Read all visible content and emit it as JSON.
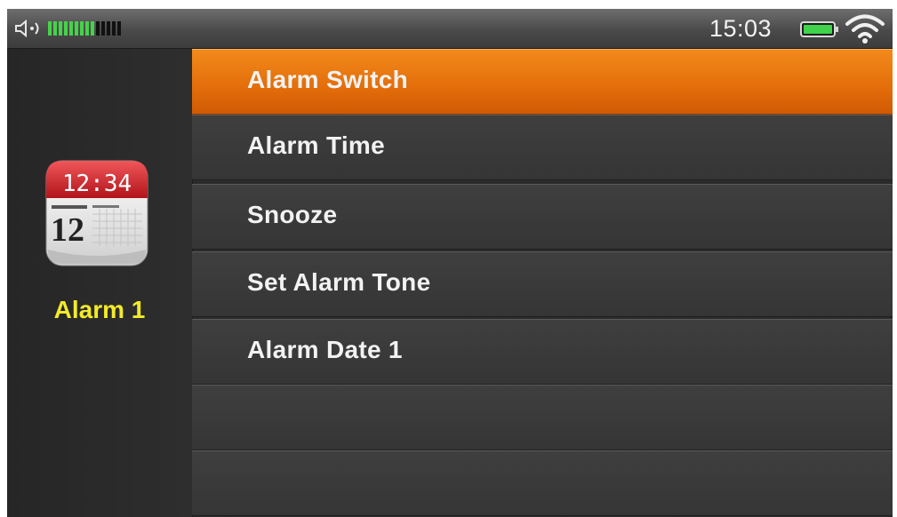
{
  "status_bar": {
    "time": "15:03",
    "volume_level": 0.6,
    "icons": [
      "speaker-icon",
      "battery-icon",
      "wifi-icon"
    ],
    "colors": {
      "volume_on": "#46d24a",
      "battery": "#3fd24a"
    }
  },
  "sidebar": {
    "app_label": "Alarm 1",
    "app_icon": "calendar-clock-icon",
    "icon_time_display": "12:34",
    "icon_date_number": "12",
    "colors": {
      "label": "#f2ea2a"
    }
  },
  "menu": {
    "selected_index": 0,
    "items": [
      {
        "label": "Alarm Switch"
      },
      {
        "label": "Alarm Time"
      },
      {
        "label": "Snooze"
      },
      {
        "label": "Set Alarm Tone"
      },
      {
        "label": "Alarm Date 1"
      },
      {
        "label": ""
      },
      {
        "label": ""
      }
    ],
    "colors": {
      "selected": "#e36d0a"
    }
  }
}
